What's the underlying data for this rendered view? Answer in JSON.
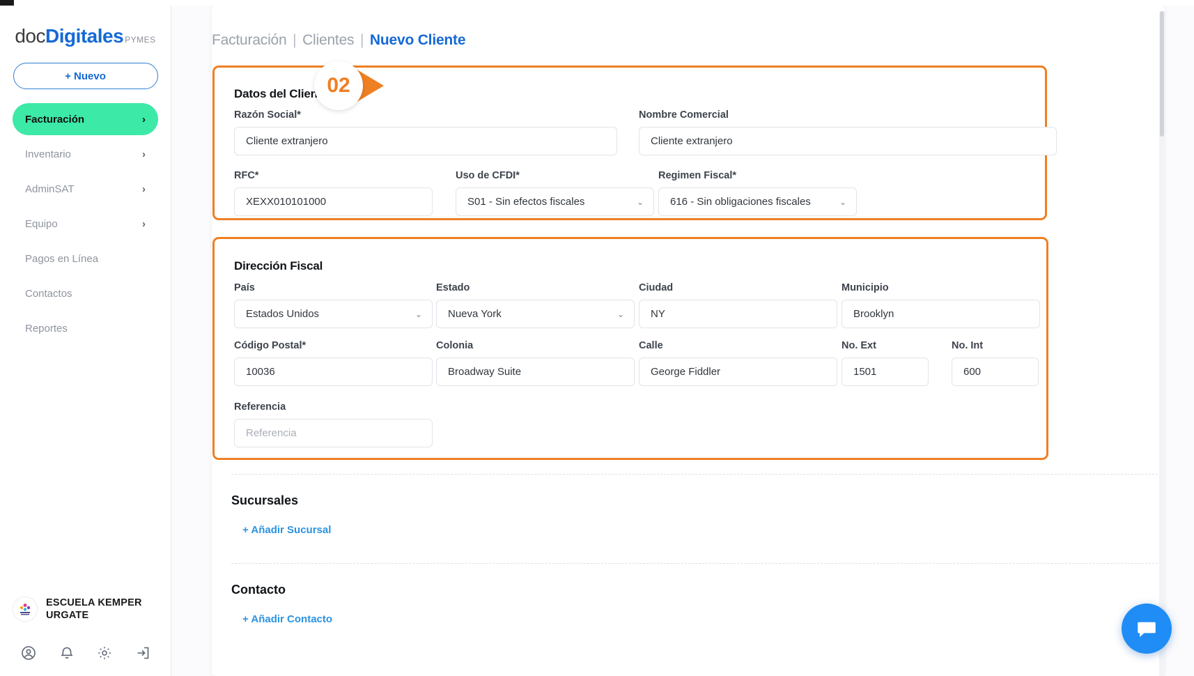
{
  "brand": {
    "part1": "doc",
    "part2": "Digitales",
    "suffix": "PYMES"
  },
  "sidebar": {
    "new_button": "+ Nuevo",
    "items": [
      {
        "label": "Facturación",
        "chevron": "›",
        "active": true
      },
      {
        "label": "Inventario",
        "chevron": "›",
        "active": false
      },
      {
        "label": "AdminSAT",
        "chevron": "›",
        "active": false
      },
      {
        "label": "Equipo",
        "chevron": "›",
        "active": false
      },
      {
        "label": "Pagos en Línea",
        "chevron": "",
        "active": false
      },
      {
        "label": "Contactos",
        "chevron": "",
        "active": false
      },
      {
        "label": "Reportes",
        "chevron": "",
        "active": false
      }
    ],
    "user": {
      "name": "ESCUELA KEMPER URGATE",
      "avatar_icon": "kemper-urgate-logo"
    },
    "footer_icons": [
      "account-circle-icon",
      "bell-icon",
      "gear-icon",
      "logout-icon"
    ]
  },
  "breadcrumb": {
    "item1": "Facturación",
    "sep1": "|",
    "item2": "Clientes",
    "sep2": "|",
    "current": "Nuevo Cliente"
  },
  "step_badge": {
    "number": "02"
  },
  "datos_cliente": {
    "title": "Datos del Cliente",
    "razon_social": {
      "label": "Razón Social*",
      "value": "Cliente extranjero"
    },
    "nombre_comercial": {
      "label": "Nombre Comercial",
      "value": "Cliente extranjero"
    },
    "rfc": {
      "label": "RFC*",
      "value": "XEXX010101000"
    },
    "uso_cfdi": {
      "label": "Uso de CFDI*",
      "value": "S01 - Sin efectos fiscales",
      "caret": "⌄"
    },
    "regimen_fiscal": {
      "label": "Regimen Fiscal*",
      "value": "616 - Sin obligaciones fiscales",
      "caret": "⌄"
    }
  },
  "direccion_fiscal": {
    "title": "Dirección Fiscal",
    "pais": {
      "label": "País",
      "value": "Estados Unidos",
      "caret": "⌄"
    },
    "estado": {
      "label": "Estado",
      "value": "Nueva York",
      "caret": "⌄"
    },
    "ciudad": {
      "label": "Ciudad",
      "value": "NY"
    },
    "municipio": {
      "label": "Municipio",
      "value": "Brooklyn"
    },
    "codigo_postal": {
      "label": "Código Postal*",
      "value": "10036"
    },
    "colonia": {
      "label": "Colonia",
      "value": "Broadway Suite"
    },
    "calle": {
      "label": "Calle",
      "value": "George Fiddler"
    },
    "no_ext": {
      "label": "No. Ext",
      "value": "1501"
    },
    "no_int": {
      "label": "No. Int",
      "value": "600"
    },
    "referencia": {
      "label": "Referencia",
      "value": "",
      "placeholder": "Referencia"
    }
  },
  "sucursales": {
    "title": "Sucursales",
    "add_link": "+ Añadir Sucursal"
  },
  "contacto": {
    "title": "Contacto",
    "add_link": "+ Añadir Contacto"
  },
  "chat": {
    "icon": "chat-bubble-icon"
  },
  "colors": {
    "accent_orange": "#ef7f23",
    "brand_blue": "#1569d6",
    "active_green": "#3ce9a6",
    "link_blue": "#2b93e0",
    "chat_blue": "#1f8df5"
  }
}
